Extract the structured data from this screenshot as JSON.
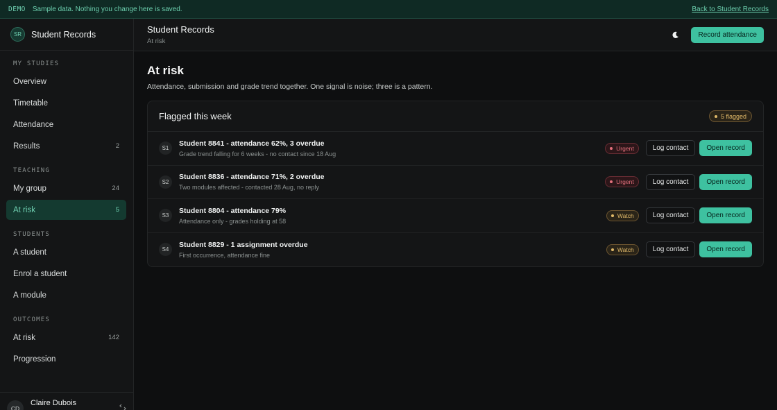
{
  "demo_bar": {
    "tag": "DEMO",
    "text": "Sample data. Nothing you change here is saved.",
    "back_link": "Back to Student Records"
  },
  "brand": {
    "initials": "SR",
    "name": "Student Records"
  },
  "sidebar": {
    "sections": [
      {
        "heading": "MY STUDIES",
        "items": [
          {
            "label": "Overview",
            "count": ""
          },
          {
            "label": "Timetable",
            "count": ""
          },
          {
            "label": "Attendance",
            "count": ""
          },
          {
            "label": "Results",
            "count": "2"
          }
        ]
      },
      {
        "heading": "TEACHING",
        "items": [
          {
            "label": "My group",
            "count": "24"
          },
          {
            "label": "At risk",
            "count": "5"
          }
        ]
      },
      {
        "heading": "STUDENTS",
        "items": [
          {
            "label": "A student",
            "count": ""
          },
          {
            "label": "Enrol a student",
            "count": ""
          },
          {
            "label": "A module",
            "count": ""
          }
        ]
      },
      {
        "heading": "OUTCOMES",
        "items": [
          {
            "label": "At risk",
            "count": "142"
          },
          {
            "label": "Progression",
            "count": ""
          }
        ]
      }
    ],
    "user": {
      "initials": "CD",
      "name": "Claire Dubois"
    }
  },
  "header": {
    "title": "Student Records",
    "breadcrumb": "At risk",
    "primary_button": "Record attendance",
    "theme_icon": "moon-icon"
  },
  "main": {
    "title": "At risk",
    "subtitle": "Attendance, submission and grade trend together. One signal is noise; three is a pattern.",
    "card": {
      "title": "Flagged this week",
      "badge": "5 flagged",
      "log_label": "Log contact",
      "open_label": "Open record",
      "rows": [
        {
          "idx": "S1",
          "title": "Student 8841 - attendance 62%, 3 overdue",
          "desc": "Grade trend falling for 6 weeks - no contact since 18 Aug",
          "status": "Urgent"
        },
        {
          "idx": "S2",
          "title": "Student 8836 - attendance 71%, 2 overdue",
          "desc": "Two modules affected - contacted 28 Aug, no reply",
          "status": "Urgent"
        },
        {
          "idx": "S3",
          "title": "Student 8804 - attendance 79%",
          "desc": "Attendance only - grades holding at 58",
          "status": "Watch"
        },
        {
          "idx": "S4",
          "title": "Student 8829 - 1 assignment overdue",
          "desc": "First occurrence, attendance fine",
          "status": "Watch"
        }
      ]
    }
  },
  "colors": {
    "accent": "#3ec1a0",
    "urgent": "#e3707c",
    "watch": "#e0b969",
    "background": "#0e0f10"
  }
}
